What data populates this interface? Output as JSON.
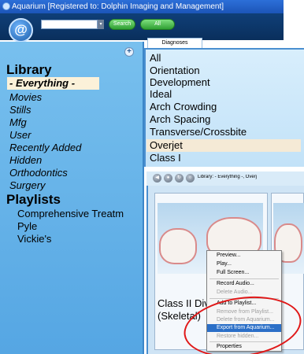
{
  "window": {
    "title": "Aquarium [Registered to: Dolphin Imaging and Management]"
  },
  "toolbar": {
    "search_value": "",
    "search_label": "Search",
    "all_label": "All"
  },
  "sidebar": {
    "library_title": "Library",
    "library_items": [
      {
        "label": "- Everything -",
        "selected": true
      },
      {
        "label": "Movies"
      },
      {
        "label": "Stills"
      },
      {
        "label": "Mfg"
      },
      {
        "label": "User"
      },
      {
        "label": "Recently Added"
      },
      {
        "label": "Hidden"
      },
      {
        "label": "Orthodontics"
      },
      {
        "label": "Surgery"
      }
    ],
    "playlists_title": "Playlists",
    "playlists": [
      {
        "label": "Comprehensive Treatm"
      },
      {
        "label": "Pyle"
      },
      {
        "label": "Vickie's"
      }
    ]
  },
  "diagnoses": {
    "tab_label": "Diagnoses",
    "items": [
      {
        "label": "All"
      },
      {
        "label": "Orientation"
      },
      {
        "label": "Development"
      },
      {
        "label": "Ideal"
      },
      {
        "label": "Arch Crowding"
      },
      {
        "label": "Arch Spacing"
      },
      {
        "label": "Transverse/Crossbite"
      },
      {
        "label": "Overjet",
        "selected": true
      },
      {
        "label": "Class I"
      }
    ]
  },
  "media": {
    "library_path": "Library: - Everything -, Overj",
    "video_title_line1": "Class II Div",
    "video_title_line2": "(Skeletal)"
  },
  "context_menu": {
    "items": [
      {
        "label": "Preview...",
        "disabled": false
      },
      {
        "label": "Play...",
        "disabled": false
      },
      {
        "label": "Full Screen...",
        "disabled": false
      },
      {
        "label": "Record Audio...",
        "disabled": false
      },
      {
        "label": "Delete Audio...",
        "disabled": true
      },
      {
        "label": "Add to Playlist...",
        "disabled": false
      },
      {
        "label": "Remove from Playlist...",
        "disabled": true
      },
      {
        "label": "Delete from Aquarium...",
        "disabled": true
      },
      {
        "label": "Export from Aquarium...",
        "disabled": false,
        "highlighted": true
      },
      {
        "label": "Restore hidden...",
        "disabled": true
      },
      {
        "label": "Properties",
        "disabled": false
      }
    ]
  },
  "colors": {
    "annotation": "#e01818",
    "highlight": "#2b6fc7",
    "sidebar": "#6bb6ea"
  }
}
